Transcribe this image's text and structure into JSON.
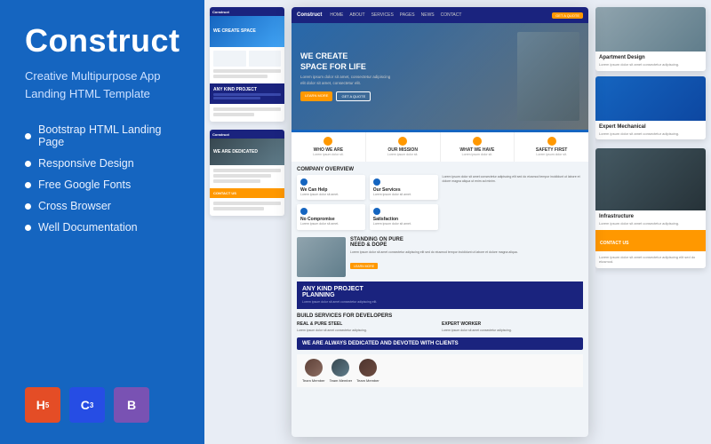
{
  "brand": {
    "title": "Construct",
    "subtitle_line1": "Creative Multipurpose App",
    "subtitle_line2": "Landing HTML Template"
  },
  "features": [
    {
      "label": "Bootstrap HTML Landing Page"
    },
    {
      "label": "Responsive Design"
    },
    {
      "label": "Free Google Fonts"
    },
    {
      "label": "Cross Browser"
    },
    {
      "label": "Well Documentation"
    }
  ],
  "badges": [
    {
      "label": "HTML5",
      "class": "badge-html",
      "symbol": "5"
    },
    {
      "label": "CSS3",
      "class": "badge-css",
      "symbol": "3"
    },
    {
      "label": "Bootstrap",
      "class": "badge-bootstrap",
      "symbol": "B"
    }
  ],
  "preview": {
    "nav": {
      "brand": "Construct",
      "links": [
        "HOME",
        "ABOUT",
        "SERVICES",
        "PAGES",
        "NEWS",
        "CONTACT"
      ],
      "cta": "GET A QUOTE"
    },
    "hero": {
      "headline": "WE CREATE\nSPACE FOR LIFE",
      "subtext": "Lorem ipsum dolor sit amet, consectetur adipiscing elit dolor sit amet, consectetur elit.",
      "btn_primary": "LEARN MORE",
      "btn_outline": "GET A QUOTE"
    },
    "feature_icons": [
      {
        "title": "WHO WE ARE",
        "desc": "Lorem ipsum dolor sit amet."
      },
      {
        "title": "OUR MISSION",
        "desc": "Lorem ipsum dolor sit amet."
      },
      {
        "title": "WHAT WE HAVE",
        "desc": "Lorem ipsum dolor sit amet."
      },
      {
        "title": "SAFETY FIRST",
        "desc": "Lorem ipsum dolor sit amet."
      }
    ],
    "company_overview": {
      "heading": "COMPANY OVERVIEW",
      "text": "Lorem ipsum dolor sit amet consectetur adipiscing elit sed do eiusmod tempor incididunt ut labore et dolore."
    },
    "standing_section": {
      "heading": "STANDING ON PURE\nNEED & DOPE",
      "text": "Lorem ipsum dolor sit amet consectetur adipiscing elit sed do eiusmod tempor incididunt ut labore et dolore magna aliqua."
    },
    "build_services": {
      "heading": "BUILD SERVICES FOR\nDEVELOPERS",
      "sub1": "REAL & PURE STEEL",
      "sub2": "EXPERT WORKER",
      "desc1": "Lorem ipsum dolor sit amet.",
      "desc2": "Lorem ipsum dolor sit amet."
    },
    "dark_section": {
      "heading": "ANY KIND PROJECT\nPLANNING",
      "text": "Lorem ipsum dolor sit amet consectetur."
    },
    "dedication": {
      "text": "We Are Always Dedicated And Devoted With Clients"
    }
  },
  "side_cards": [
    {
      "title": "Apartment Design",
      "text": "Lorem ipsum dolor sit amet consectetur adipiscing."
    },
    {
      "title": "Expert Mechanical",
      "text": "Lorem ipsum dolor sit amet consectetur adipiscing."
    }
  ]
}
